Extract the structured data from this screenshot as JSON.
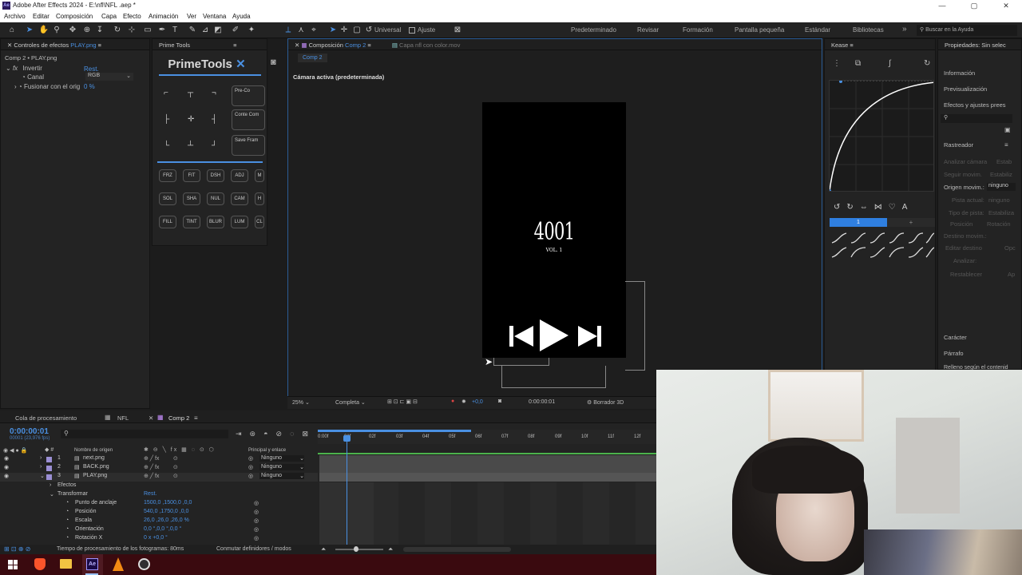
{
  "titlebar": {
    "app_badge": "Ae",
    "title": "Adobe After Effects 2024 - E:\\nfl\\NFL .aep *",
    "minimize": "—",
    "maximize": "▢",
    "close": "✕"
  },
  "menu": [
    "Archivo",
    "Editar",
    "Composición",
    "Capa",
    "Efecto",
    "Animación",
    "Ver",
    "Ventana",
    "Ayuda"
  ],
  "toolbar": {
    "universal_label": "Universal",
    "snap_label": "Ajuste",
    "workspaces": [
      "Predeterminado",
      "Revisar",
      "Formación",
      "Pantalla pequeña",
      "Estándar",
      "Bibliotecas"
    ],
    "more": "»",
    "search_placeholder": "Buscar en la Ayuda"
  },
  "effects_panel": {
    "tab": "Controles de efectos",
    "layer": "PLAY.png",
    "breadcrumb": "Comp 2 • PLAY.png",
    "effect_name": "Invertir",
    "reset": "Rest.",
    "canal_label": "Canal",
    "canal_value": "RGB",
    "blend_label": "Fusionar con el orig",
    "blend_value": "0 %"
  },
  "primetools": {
    "tab": "Prime Tools",
    "logo": "PrimeTools",
    "big_buttons": [
      "Pre-Co",
      "Conte Com",
      "Save Fram"
    ],
    "buttons_row1": [
      "FRZ",
      "FIT",
      "DSH",
      "ADJ",
      "M"
    ],
    "buttons_row2": [
      "SOL",
      "SHA",
      "NUL",
      "CAM",
      "H"
    ],
    "buttons_row3": [
      "FILL",
      "TINT",
      "BLUR",
      "LUM",
      "CL"
    ]
  },
  "composition": {
    "tab_prefix": "Composición",
    "tab_name": "Comp 2",
    "layer_tab": "Capa  nfl con color.mov",
    "subtab": "Comp 2",
    "camera_label": "Cámara activa (predeterminada)",
    "artwork_title": "4001",
    "artwork_sub": "VOL. 1",
    "zoom": "25%",
    "quality": "Completa",
    "exposure": "+0,0",
    "timecode": "0:00:00:01",
    "renderer": "Borrador 3D"
  },
  "kease": {
    "tab": "Kease",
    "preset_active": "1",
    "preset_add": "+"
  },
  "right_panel": {
    "header": "Propiedades: Sin selec",
    "info": "Información",
    "preview": "Previsualización",
    "effects_presets": "Efectos y ajustes prees",
    "tracker": "Rastreador",
    "tracker_items": [
      "Analizar cámara",
      "Estab",
      "Seguir movim.",
      "Estabiliz"
    ],
    "origin_label": "Origen movim.:",
    "origin_value": "ninguno",
    "track_items": [
      "Pista actual:",
      "ninguno",
      "Tipo de pista:",
      "Estabiliza",
      "Posición",
      "Rotación",
      "Destino movim.:",
      "Editar destino",
      "Opc",
      "Analizar:",
      "Restablecer",
      "Ap"
    ],
    "character": "Carácter",
    "paragraph": "Párrafo",
    "fill_text": "Relleno según el contenid"
  },
  "timeline": {
    "tabs": [
      "Cola de procesamiento",
      "NFL",
      "Comp 2"
    ],
    "timecode": "0:00:00:01",
    "fps": "00001 (23,976 fps)",
    "col_source": "Nombre de origen",
    "col_parent": "Principal y enlace",
    "ruler": [
      "0:00f",
      "01f",
      "02f",
      "03f",
      "04f",
      "05f",
      "06f",
      "07f",
      "08f",
      "09f",
      "10f",
      "11f",
      "12f"
    ],
    "layers": [
      {
        "num": "1",
        "name": "next.png",
        "parent": "Ninguno",
        "color": "#9b8fd4"
      },
      {
        "num": "2",
        "name": "BACK.png",
        "parent": "Ninguno",
        "color": "#9b8fd4"
      },
      {
        "num": "3",
        "name": "PLAY.png",
        "parent": "Ninguno",
        "color": "#9b8fd4"
      }
    ],
    "props": [
      {
        "name": "Efectos",
        "value": ""
      },
      {
        "name": "Transformar",
        "value": "Rest."
      },
      {
        "name": "Punto de anclaje",
        "value": "1500,0 ,1500,0 ,0,0"
      },
      {
        "name": "Posición",
        "value": "540,0 ,1750,0 ,0,0"
      },
      {
        "name": "Escala",
        "value": "26,0 ,26,0 ,26,0 %"
      },
      {
        "name": "Orientación",
        "value": "0,0 °,0,0 °,0,0 °"
      },
      {
        "name": "Rotación X",
        "value": "0 x +0,0 °"
      }
    ],
    "footer_time": "Tiempo de procesamiento de los fotogramas: 80ms",
    "footer_toggle": "Conmutar definidores / modos"
  },
  "taskbar": {
    "apps": [
      "windows-icon",
      "brave-icon",
      "explorer-icon",
      "after-effects-icon",
      "vlc-icon",
      "obs-icon"
    ],
    "ae_badge": "Ae"
  },
  "colors": {
    "accent": "#4a90e2",
    "taskbar": "#3a0a0f",
    "track_green": "#4cb34c"
  }
}
